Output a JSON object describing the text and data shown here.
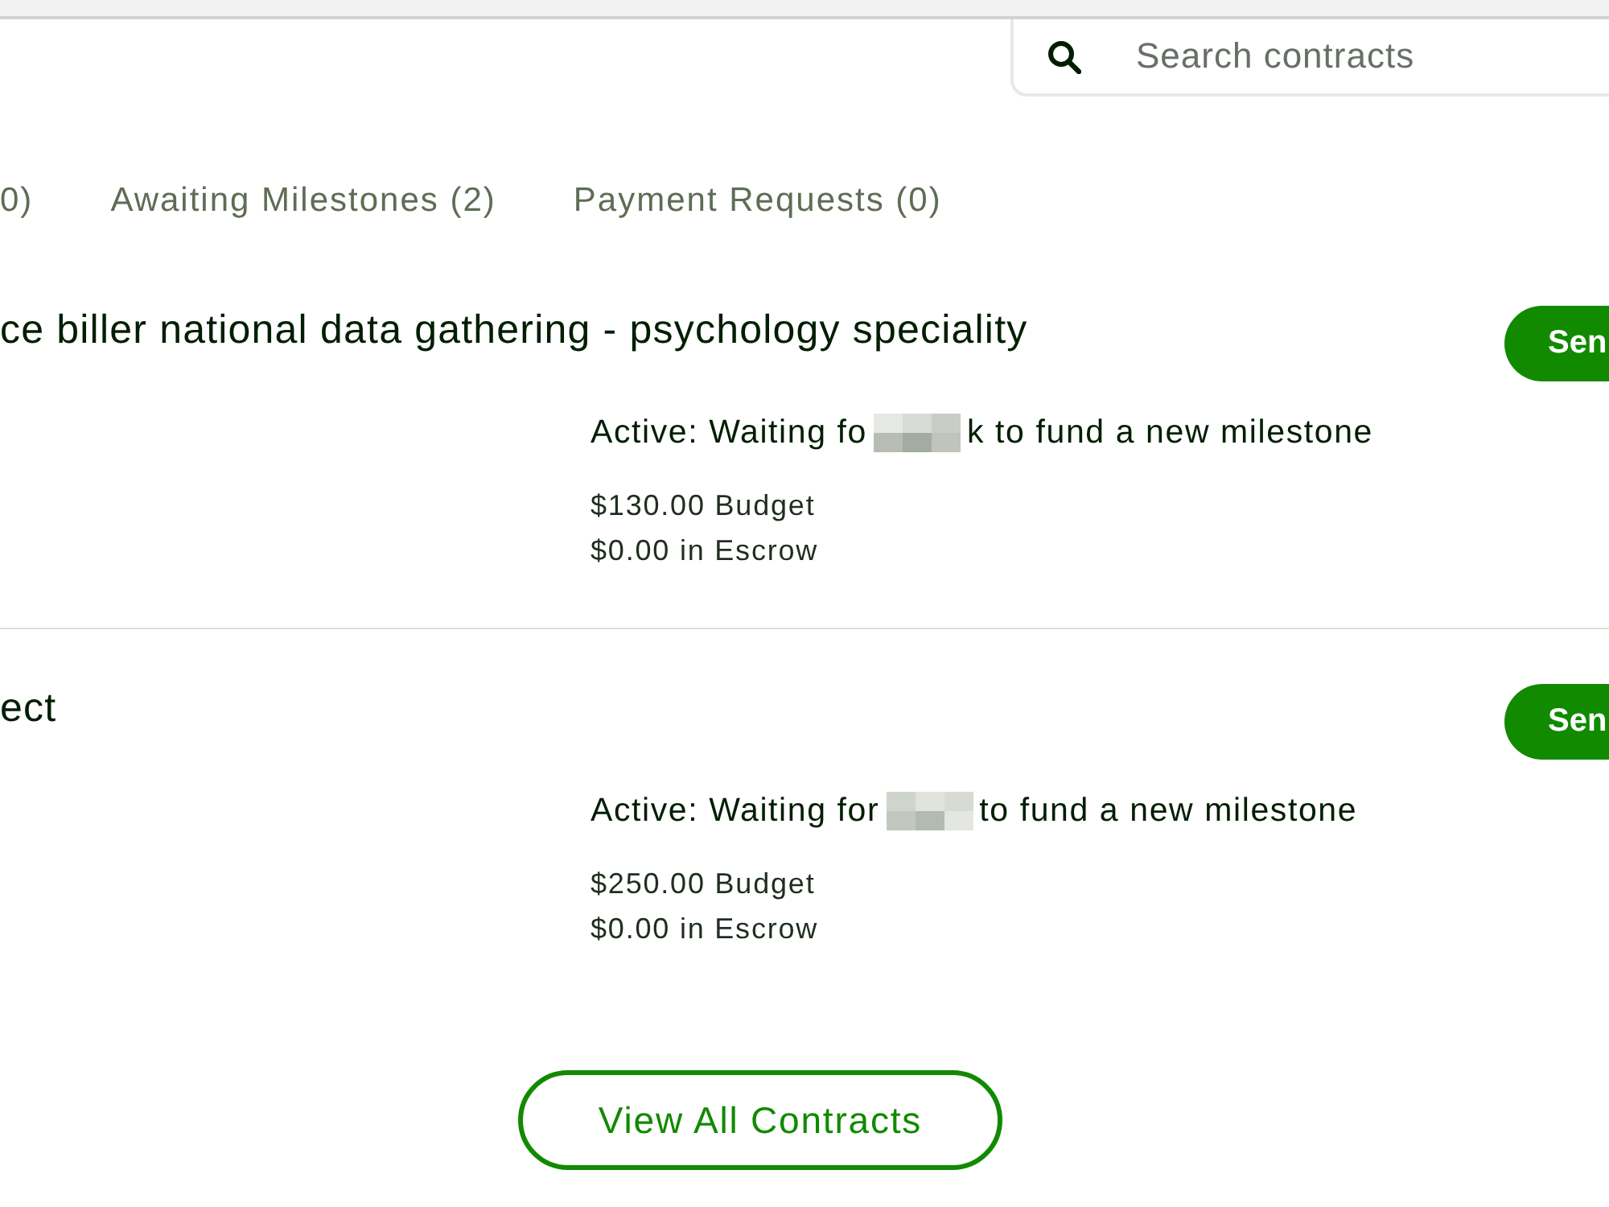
{
  "search": {
    "placeholder": "Search contracts"
  },
  "tabs": [
    {
      "label": "0)",
      "selected": false
    },
    {
      "label": "Awaiting Milestones (2)",
      "selected": false
    },
    {
      "label": "Payment Requests (0)",
      "selected": false
    }
  ],
  "contracts": [
    {
      "title": "ce biller national data gathering - psychology speciality",
      "status_before": "Active: Waiting fo",
      "status_after": "k to fund a new milestone",
      "budget": "$130.00 Budget",
      "escrow": "$0.00 in Escrow",
      "action": "Sen"
    },
    {
      "title": "ect",
      "status_before": "Active: Waiting for",
      "status_after": "to fund a new milestone",
      "budget": "$250.00 Budget",
      "escrow": "$0.00 in Escrow",
      "action": "Sen"
    }
  ],
  "view_all_button": "View All Contracts"
}
